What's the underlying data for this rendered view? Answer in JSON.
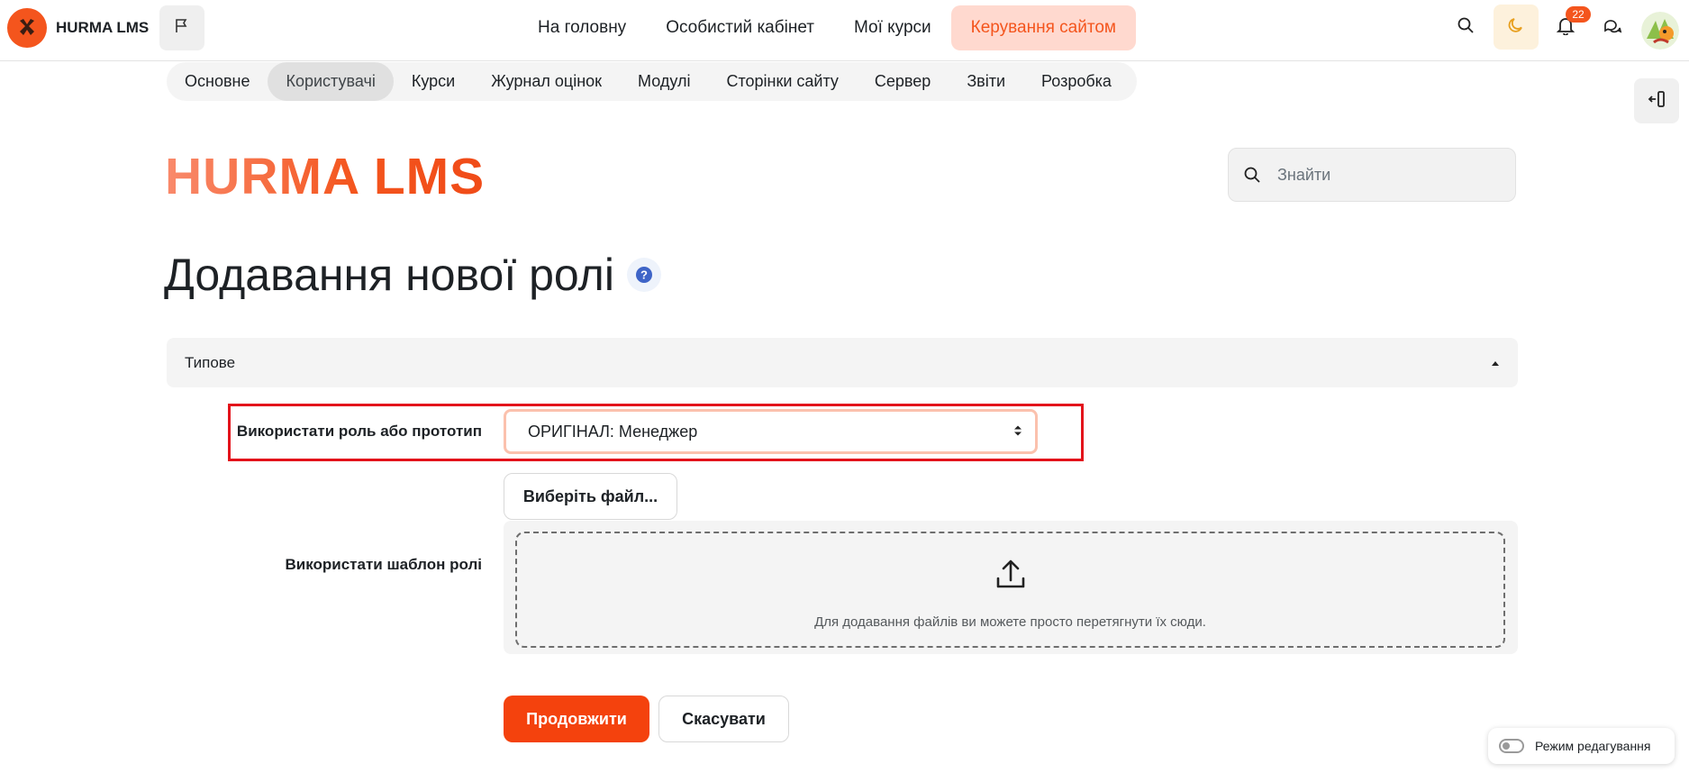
{
  "brand": {
    "name": "HURMA LMS",
    "accent": "#f4551d"
  },
  "nav": {
    "links": [
      "На головну",
      "Особистий кабінет",
      "Мої курси",
      "Керування сайтом"
    ],
    "active_index": 3,
    "notification_count": "22"
  },
  "subnav": {
    "items": [
      "Основне",
      "Користувачі",
      "Курси",
      "Журнал оцінок",
      "Модулі",
      "Сторінки сайту",
      "Сервер",
      "Звіти",
      "Розробка"
    ],
    "active_index": 1
  },
  "site_title": "HURMA LMS",
  "search": {
    "placeholder": "Знайти"
  },
  "page_title": "Додавання нової ролі",
  "section": {
    "title": "Типове",
    "expanded": true
  },
  "form": {
    "prototype_label": "Використати роль або прототип",
    "prototype_value": "ОРИГІНАЛ: Менеджер",
    "template_label": "Використати шаблон ролі",
    "file_button": "Виберіть файл...",
    "dropzone_text": "Для додавання файлів ви можете просто перетягнути їх сюди."
  },
  "buttons": {
    "continue": "Продовжити",
    "cancel": "Скасувати"
  },
  "edit_mode": {
    "label": "Режим редагування",
    "enabled": false
  },
  "icons": {
    "flag": "flag-icon",
    "search": "search-icon",
    "moon": "moon-icon",
    "bell": "bell-icon",
    "messages": "chat-icon",
    "help": "help-icon",
    "upload": "upload-icon",
    "drawer": "drawer-open-icon"
  }
}
